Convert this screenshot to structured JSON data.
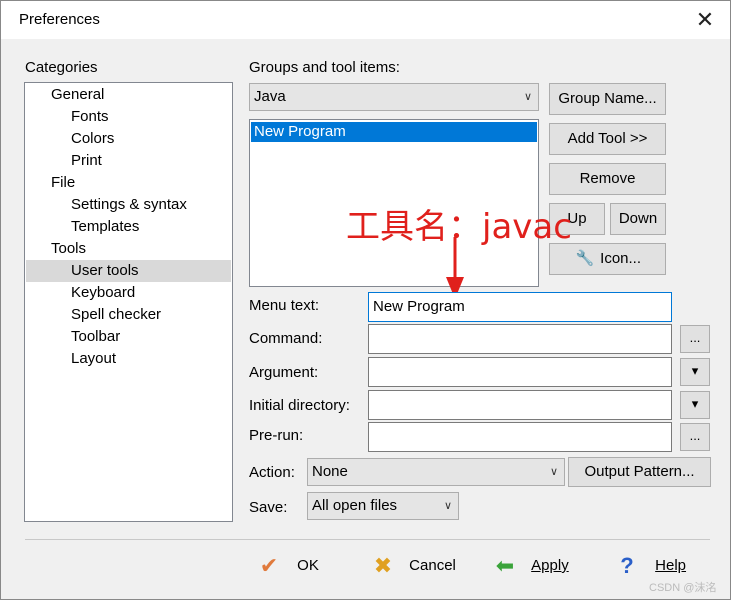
{
  "window": {
    "title": "Preferences",
    "close_glyph": "✕"
  },
  "categories": {
    "label": "Categories",
    "items": [
      {
        "label": "General",
        "level": 0
      },
      {
        "label": "Fonts",
        "level": 1
      },
      {
        "label": "Colors",
        "level": 1
      },
      {
        "label": "Print",
        "level": 1
      },
      {
        "label": "File",
        "level": 0
      },
      {
        "label": "Settings & syntax",
        "level": 1
      },
      {
        "label": "Templates",
        "level": 1
      },
      {
        "label": "Tools",
        "level": 0
      },
      {
        "label": "User tools",
        "level": 1,
        "selected": true
      },
      {
        "label": "Keyboard",
        "level": 1
      },
      {
        "label": "Spell checker",
        "level": 1
      },
      {
        "label": "Toolbar",
        "level": 1
      },
      {
        "label": "Layout",
        "level": 1
      }
    ]
  },
  "groups": {
    "label": "Groups and tool items:",
    "selected_group": "Java",
    "tool_items": [
      "New Program"
    ]
  },
  "side_buttons": {
    "group_name": "Group Name...",
    "add_tool": "Add Tool >>",
    "remove": "Remove",
    "up": "Up",
    "down": "Down",
    "icon": "Icon..."
  },
  "annotation": {
    "text": "工具名：javac",
    "color": "#e0201c"
  },
  "fields": {
    "menu_text": {
      "label": "Menu text:",
      "value": "New Program"
    },
    "command": {
      "label": "Command:",
      "value": "",
      "button": "..."
    },
    "argument": {
      "label": "Argument:",
      "value": "",
      "button": "▾"
    },
    "initial_directory": {
      "label": "Initial directory:",
      "value": "",
      "button": "▾"
    },
    "pre_run": {
      "label": "Pre-run:",
      "value": "",
      "button": "..."
    }
  },
  "action": {
    "label": "Action:",
    "value": "None",
    "output_pattern": "Output Pattern..."
  },
  "save": {
    "label": "Save:",
    "value": "All open files"
  },
  "footer": {
    "ok": "OK",
    "cancel": "Cancel",
    "apply": "Apply",
    "help": "Help"
  },
  "watermark": "CSDN @沫洺",
  "icons": {
    "ok": "check-icon",
    "cancel": "x-icon",
    "apply": "arrow-left-icon",
    "help": "question-icon",
    "tool": "wrench-icon"
  }
}
